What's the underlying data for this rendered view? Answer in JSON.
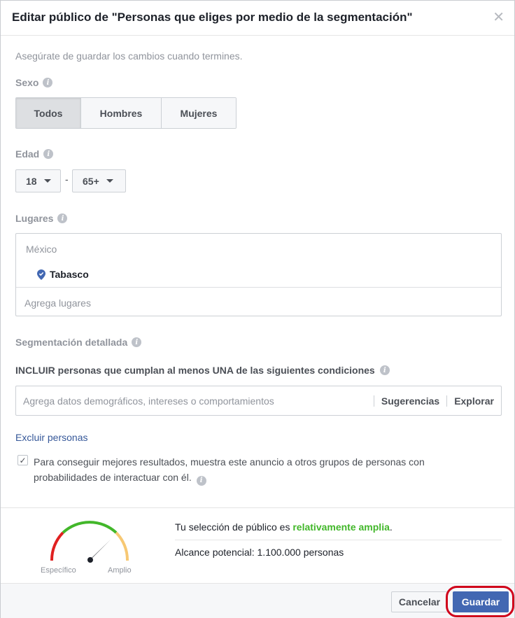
{
  "dialog": {
    "title": "Editar público de \"Personas que eliges por medio de la segmentación\"",
    "close_icon": "close-icon",
    "hint": "Asegúrate de guardar los cambios cuando termines."
  },
  "gender": {
    "label": "Sexo",
    "options": [
      "Todos",
      "Hombres",
      "Mujeres"
    ],
    "selected": "Todos"
  },
  "age": {
    "label": "Edad",
    "min": "18",
    "max": "65+",
    "separator": "-"
  },
  "places": {
    "label": "Lugares",
    "country": "México",
    "items": [
      "Tabasco"
    ],
    "placeholder": "Agrega lugares"
  },
  "detailed": {
    "label": "Segmentación detallada",
    "include_label": "INCLUIR personas que cumplan al menos UNA de las siguientes condiciones",
    "placeholder": "Agrega datos demográficos, intereses o comportamientos",
    "suggestions": "Sugerencias",
    "explore": "Explorar",
    "exclude_link": "Excluir personas",
    "expansion_checked": true,
    "expansion_text": "Para conseguir mejores resultados, muestra este anuncio a otros grupos de personas con probabilidades de interactuar con él."
  },
  "audience": {
    "gauge_left_label": "Específico",
    "gauge_right_label": "Amplio",
    "summary_prefix": "Tu selección de público es ",
    "summary_strong": "relativamente amplia",
    "summary_suffix": ".",
    "reach": "Alcance potencial: 1.100.000 personas",
    "colors": {
      "specific": "#e02020",
      "balanced": "#42b72a",
      "broad": "#f7c873",
      "strong_text": "#42b72a"
    }
  },
  "buttons": {
    "cancel": "Cancelar",
    "save": "Guardar",
    "save_color": "#4267b2",
    "highlight_color": "#d0021b"
  }
}
